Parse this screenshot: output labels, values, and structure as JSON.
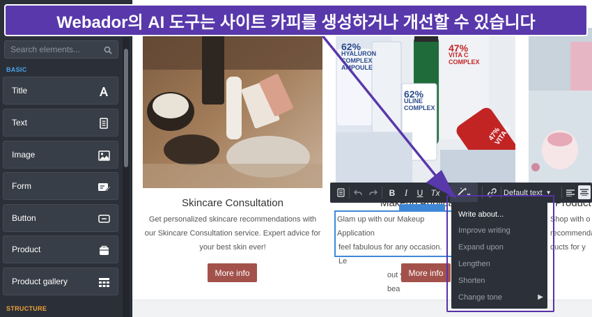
{
  "banner": {
    "text": "Webador의 AI 도구는 사이트 카피를 생성하거나 개선할 수 있습니다"
  },
  "sidebar": {
    "search_placeholder": "Search elements...",
    "basic_label": "BASIC",
    "structure_label": "STRUCTURE",
    "items": [
      {
        "label": "Title",
        "icon": "title-icon"
      },
      {
        "label": "Text",
        "icon": "text-icon"
      },
      {
        "label": "Image",
        "icon": "image-icon"
      },
      {
        "label": "Form",
        "icon": "form-icon"
      },
      {
        "label": "Button",
        "icon": "button-icon"
      },
      {
        "label": "Product",
        "icon": "product-icon"
      },
      {
        "label": "Product gallery",
        "icon": "product-gallery-icon"
      }
    ]
  },
  "cards": [
    {
      "title": "Skincare Consultation",
      "desc": [
        "Get personalized skincare recommendations with",
        "our Skincare Consultation service. Expert advice for",
        "your best skin ever!"
      ],
      "button": "More info"
    },
    {
      "title": "Makeup Application",
      "desc": [
        "Glam up with our Makeup Application",
        "feel fabulous for any occasion. Le",
        "out your inner bea"
      ],
      "button": "More info"
    },
    {
      "title": "Product",
      "desc": [
        "Shop with o",
        "recommenda",
        "ducts for y"
      ]
    }
  ],
  "product_labels": {
    "a": [
      "62%",
      "HYALURON",
      "COMPLEX",
      "AMPOULE"
    ],
    "b": [
      "47%",
      "VITA C",
      "COMPLEX"
    ],
    "c": [
      "62%",
      "ULINE",
      "COMPLEX"
    ],
    "d": [
      "47%",
      "VITA C"
    ]
  },
  "toolbar": {
    "bold": "B",
    "italic": "I",
    "underline": "U",
    "clear": "Tx",
    "style_select": "Default text"
  },
  "ai_menu": {
    "items": [
      "Write about...",
      "Improve writing",
      "Expand upon",
      "Lengthen",
      "Shorten",
      "Change tone"
    ]
  },
  "colors": {
    "accent_purple": "#5838ab",
    "button_red": "#a3524b",
    "selection_blue": "#3f88d8",
    "sidebar_bg": "#2b3038"
  }
}
